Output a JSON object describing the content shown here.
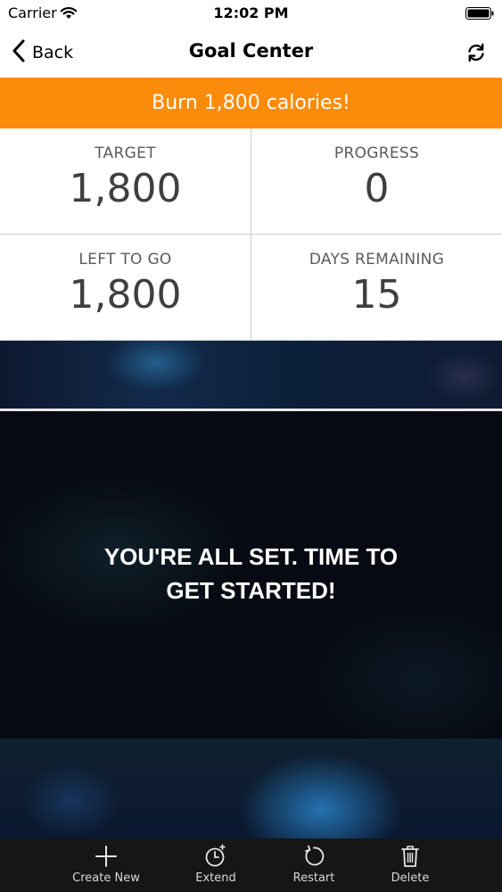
{
  "status_bar": {
    "carrier": "Carrier",
    "time": "12:02 PM"
  },
  "nav": {
    "back_label": "Back",
    "title": "Goal Center",
    "refresh_icon": "refresh-icon"
  },
  "banner": {
    "text": "Burn 1,800 calories!",
    "color": "#fb8c0b"
  },
  "stats": [
    {
      "label": "TARGET",
      "value": "1,800"
    },
    {
      "label": "PROGRESS",
      "value": "0"
    },
    {
      "label": "LEFT TO GO",
      "value": "1,800"
    },
    {
      "label": "DAYS REMAINING",
      "value": "15"
    }
  ],
  "message": {
    "line1": "YOU'RE ALL SET. TIME TO",
    "line2": "GET STARTED!"
  },
  "toolbar": {
    "items": [
      {
        "label": "Create New",
        "icon": "plus-icon"
      },
      {
        "label": "Extend",
        "icon": "clock-icon"
      },
      {
        "label": "Restart",
        "icon": "restart-icon"
      },
      {
        "label": "Delete",
        "icon": "trash-icon"
      }
    ]
  }
}
